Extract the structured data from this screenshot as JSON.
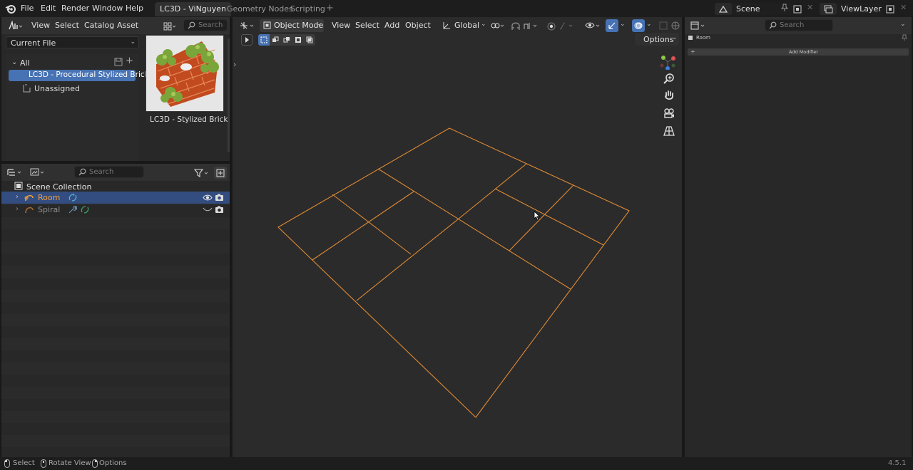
{
  "topbar": {
    "menus": [
      "File",
      "Edit",
      "Render",
      "Window",
      "Help"
    ],
    "workspaces": [
      {
        "label": "LC3D - ViNguyen",
        "active": true
      },
      {
        "label": "Geometry Nodes",
        "active": false
      },
      {
        "label": "Scripting",
        "active": false
      }
    ],
    "scene_label": "Scene",
    "viewlayer_label": "ViewLayer"
  },
  "asset_browser": {
    "menus": [
      "View",
      "Select",
      "Catalog",
      "Asset"
    ],
    "search_placeholder": "Search",
    "library": "Current File",
    "catalog_root": "All",
    "catalog_selected": "LC3D - Procedural Stylized Brick",
    "catalog_unassigned": "Unassigned",
    "asset_name": "LC3D - Stylized Brick"
  },
  "outliner": {
    "search_placeholder": "Search",
    "scene_collection": "Scene Collection",
    "items": [
      {
        "label": "Room",
        "selected": true
      },
      {
        "label": "Spiral",
        "selected": false
      }
    ]
  },
  "viewport": {
    "mode": "Object Mode",
    "menus": [
      "View",
      "Select",
      "Add",
      "Object"
    ],
    "transform_orientation": "Global",
    "options_label": "Options",
    "wire_color": "#e08a34"
  },
  "properties": {
    "search_placeholder": "Search",
    "object_name": "Room",
    "add_modifier_label": "Add Modifier"
  },
  "statusbar": {
    "hints": [
      "Select",
      "Rotate View",
      "Options"
    ],
    "version": "4.5.1"
  },
  "colors": {
    "accent": "#4772b3",
    "selected_text": "#f0a040",
    "panel_bg": "#282828",
    "header_bg": "#303030"
  }
}
